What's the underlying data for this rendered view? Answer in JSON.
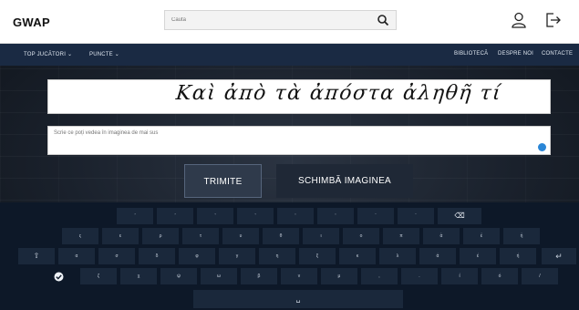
{
  "header": {
    "logo": "GWAP",
    "search_placeholder": "Caută",
    "icons": {
      "search": "search-icon",
      "user": "user-icon",
      "logout": "logout-icon"
    }
  },
  "nav": {
    "left": [
      {
        "label": "TOP JUCĂTORI ⌄"
      },
      {
        "label": "PUNCTE ⌄"
      }
    ],
    "right": [
      {
        "label": "BIBLIOTECĂ"
      },
      {
        "label": "DESPRE NOI"
      },
      {
        "label": "CONTACTE"
      }
    ]
  },
  "captcha": {
    "text": "Καὶ ἀπὸ τὰ ἀπόστα ἀληθῆ τί"
  },
  "answer": {
    "placeholder": "Scrie ce poți vedea în imaginea de mai sus"
  },
  "buttons": {
    "submit": "TRIMITE",
    "change": "SCHIMBĂ IMAGINEA"
  },
  "keyboard": {
    "row1": [
      "ʼ",
      "ʼ",
      "ʽ",
      "ʽ",
      "ʹ",
      "ʹ",
      "᾿",
      "᾿",
      "⌫"
    ],
    "row2": [
      "ς",
      "ε",
      "ρ",
      "τ",
      "υ",
      "θ",
      "ι",
      "ο",
      "π",
      "ἀ",
      "ἐ",
      "ἠ"
    ],
    "row3": [
      "⇧",
      "α",
      "σ",
      "δ",
      "φ",
      "γ",
      "η",
      "ξ",
      "κ",
      "λ",
      "ά",
      "έ",
      "ή",
      "↵"
    ],
    "row4": [
      "ζ",
      "χ",
      "ψ",
      "ω",
      "β",
      "ν",
      "μ",
      ",",
      ".",
      "ί",
      "ό",
      "/"
    ],
    "space": "␣",
    "accent": "#2a86d6"
  }
}
